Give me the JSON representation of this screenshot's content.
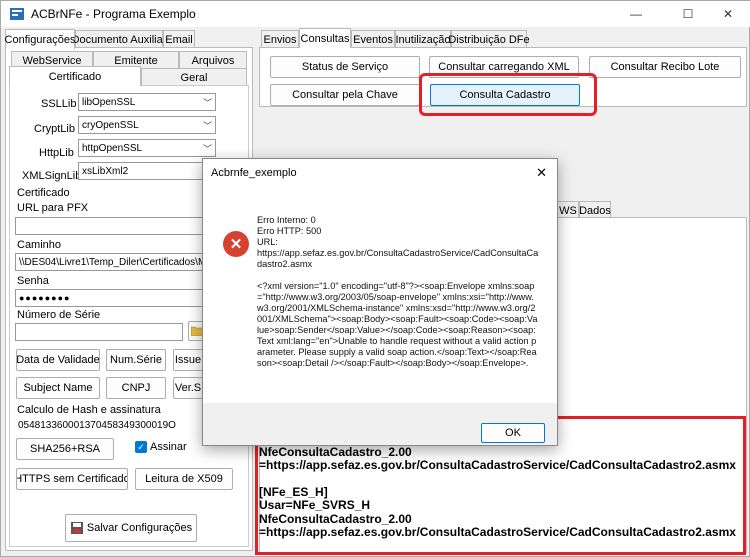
{
  "window": {
    "title": "ACBrNFe - Programa Exemplo",
    "minimize": "—",
    "maximize": "☐",
    "close": "✕"
  },
  "left": {
    "tabs": [
      "Configurações",
      "Documento Auxiliar",
      "Email"
    ],
    "subtabs_row1": [
      "WebService",
      "Emitente",
      "Arquivos"
    ],
    "subtabs_row2": [
      "Certificado",
      "Geral"
    ],
    "libs": [
      {
        "label": "SSLLib",
        "value": "libOpenSSL"
      },
      {
        "label": "CryptLib",
        "value": "cryOpenSSL"
      },
      {
        "label": "HttpLib",
        "value": "httpOpenSSL"
      },
      {
        "label": "XMLSignLib",
        "value": "xsLibXml2"
      }
    ],
    "cert_group": "Certificado",
    "url_pfx_label": "URL para PFX",
    "url_pfx_value": "",
    "caminho_label": "Caminho",
    "caminho_value": "\\\\DES04\\Livre1\\Temp_Diler\\Certificados\\Móv",
    "senha_label": "Senha",
    "senha_value": "●●●●●●●●",
    "serie_label": "Número de Série",
    "serie_value": "",
    "btn_data_validade": "Data de Validade",
    "btn_num_serie": "Num.Série",
    "btn_issuer": "Issue",
    "btn_subject": "Subject Name",
    "btn_cnpj": "CNPJ",
    "btn_ver": "Ver.S",
    "hash_group": "Calculo de Hash e assinatura",
    "hash_value": "054813360001370458349300019O",
    "btn_sha": "SHA256+RSA",
    "assinar_label": "Assinar",
    "btn_https": "HTTPS sem Certificado",
    "btn_leitura": "Leitura de X509",
    "btn_salvar": "Salvar Configurações"
  },
  "right": {
    "tabs": [
      "Envios",
      "Consultas",
      "Eventos",
      "Inutilização",
      "Distribuição DFe"
    ],
    "buttons": [
      "Status de Serviço",
      "Consultar carregando XML",
      "Consultar Recibo Lote",
      "Consultar pela Chave",
      "Consulta Cadastro"
    ],
    "result_tabs": [
      "WS",
      "Dados"
    ],
    "log_text": "[NFe_ES_P]\nUsar=NFe_SVRS_P\nNfeConsultaCadastro_2.00\n=https://app.sefaz.es.gov.br/ConsultaCadastroService/CadConsultaCadastro2.asmx\n\n[NFe_ES_H]\nUsar=NFe_SVRS_H\nNfeConsultaCadastro_2.00\n=https://app.sefaz.es.gov.br/ConsultaCadastroService/CadConsultaCadastro2.asmx"
  },
  "dialog": {
    "title": "Acbrnfe_exemplo",
    "close": "✕",
    "icon": "error-icon",
    "message": "Erro Interno: 0\nErro HTTP: 500\nURL:\nhttps://app.sefaz.es.gov.br/ConsultaCadastroService/CadConsultaCadastro2.asmx\n\n<?xml version=\"1.0\" encoding=\"utf-8\"?><soap:Envelope xmlns:soap=\"http://www.w3.org/2003/05/soap-envelope\" xmlns:xsi=\"http://www.w3.org/2001/XMLSchema-instance\" xmlns:xsd=\"http://www.w3.org/2001/XMLSchema\"><soap:Body><soap:Fault><soap:Code><soap:Value>soap:Sender</soap:Value></soap:Code><soap:Reason><soap:Text xml:lang=\"en\">Unable to handle request without a valid action parameter. Please supply a valid soap action.</soap:Text></soap:Reason><soap:Detail /></soap:Fault></soap:Body></soap:Envelope>.",
    "ok": "OK"
  },
  "colors": {
    "highlight": "#e3202a",
    "error": "#d7412f",
    "focus": "#0078d7"
  }
}
